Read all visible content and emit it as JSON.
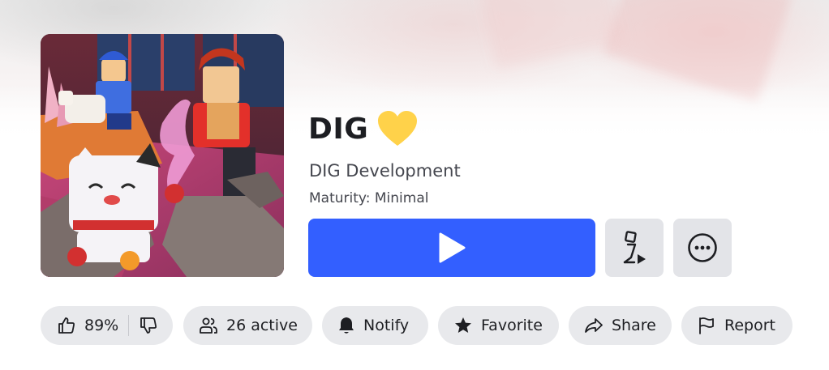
{
  "game": {
    "title": "DIG",
    "creator": "DIG Development",
    "maturity_label": "Maturity:",
    "maturity_value": "Minimal"
  },
  "stats": {
    "like_percent": "89%",
    "active": "26 active"
  },
  "actions": {
    "notify": "Notify",
    "favorite": "Favorite",
    "share": "Share",
    "report": "Report"
  },
  "colors": {
    "play_button": "#335fff",
    "pill_bg": "#e8e9ec",
    "square_button_bg": "#e3e4e8",
    "heart": "#ffd24a"
  },
  "icons": {
    "play": "play-icon",
    "server": "server-join-icon",
    "more": "more-options-icon",
    "thumbs_up": "thumbs-up-icon",
    "thumbs_down": "thumbs-down-icon",
    "people": "people-icon",
    "bell": "bell-icon",
    "star": "star-icon",
    "share": "share-arrow-icon",
    "flag": "flag-icon",
    "heart": "heart-icon"
  }
}
